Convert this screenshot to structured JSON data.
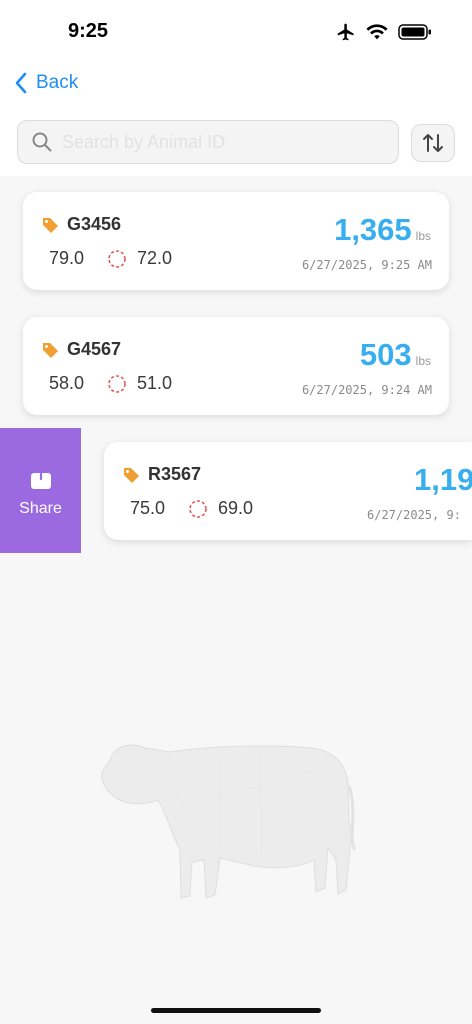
{
  "status_bar": {
    "time": "9:25"
  },
  "header": {
    "back_label": "Back",
    "search_placeholder": "Search by Animal ID"
  },
  "records": [
    {
      "id": "G3456",
      "measure_1": "79.0",
      "measure_2": "72.0",
      "weight": "1,365",
      "unit": "lbs",
      "datetime": "6/27/2025, 9:25 AM"
    },
    {
      "id": "G4567",
      "measure_1": "58.0",
      "measure_2": "51.0",
      "weight": "503",
      "unit": "lbs",
      "datetime": "6/27/2025, 9:24 AM"
    },
    {
      "id": "R3567",
      "measure_1": "75.0",
      "measure_2": "69.0",
      "weight": "1,19",
      "unit": "",
      "datetime": "6/27/2025, 9:"
    }
  ],
  "swipe_action": {
    "label": "Share",
    "color": "#9b6ae0"
  },
  "colors": {
    "accent": "#1f8ef1",
    "weight": "#36aef0",
    "tag": "#f0a032",
    "ring": "#e05a5a"
  }
}
